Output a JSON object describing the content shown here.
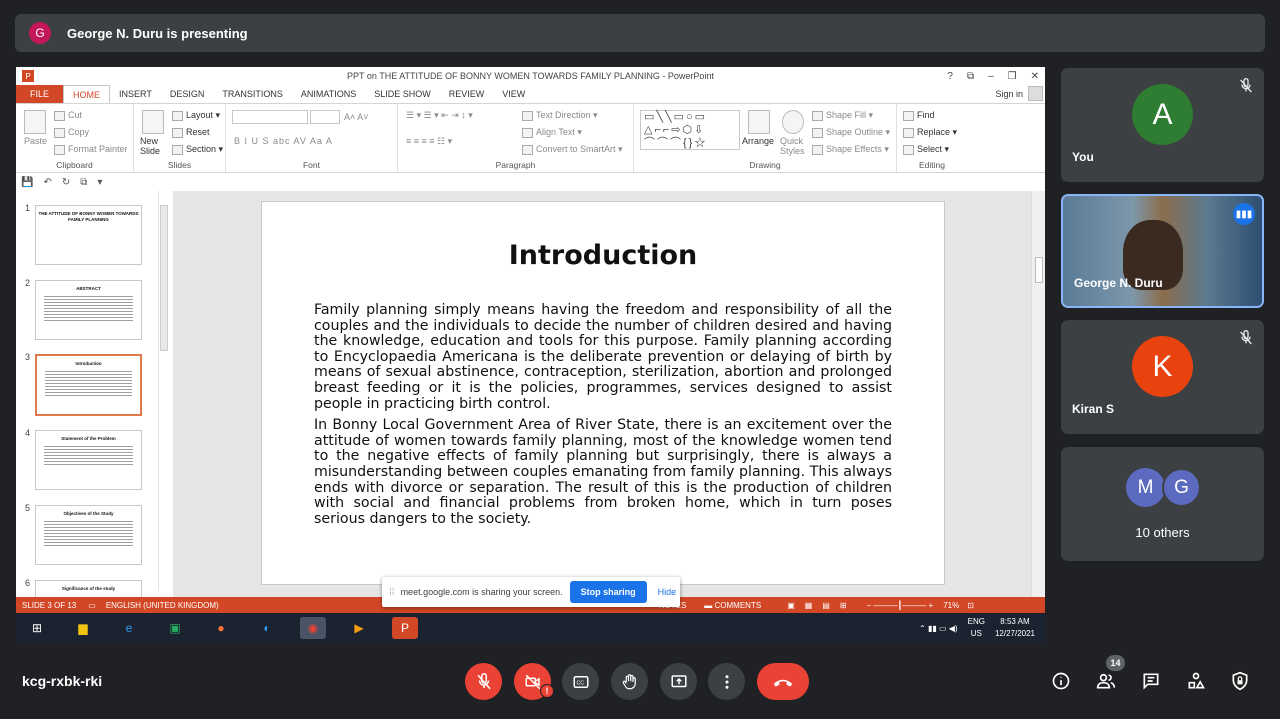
{
  "banner": {
    "avatar_letter": "G",
    "text": "George N. Duru is presenting"
  },
  "ppt": {
    "window_title": "PPT on THE ATTITUDE OF BONNY WOMEN TOWARDS FAMILY PLANNING - PowerPoint",
    "window_controls": [
      "?",
      "⧉",
      "–",
      "❐",
      "✕"
    ],
    "tabs": [
      "FILE",
      "HOME",
      "INSERT",
      "DESIGN",
      "TRANSITIONS",
      "ANIMATIONS",
      "SLIDE SHOW",
      "REVIEW",
      "VIEW"
    ],
    "sign_in": "Sign in",
    "ribbon": {
      "clipboard": {
        "label": "Clipboard",
        "paste": "Paste",
        "cut": "Cut",
        "copy": "Copy",
        "format_painter": "Format Painter"
      },
      "slides": {
        "label": "Slides",
        "new_slide": "New Slide",
        "layout": "Layout",
        "reset": "Reset",
        "section": "Section"
      },
      "font": {
        "label": "Font",
        "buttons": "B  I  U  S  abc  AV  Aa  A"
      },
      "paragraph": {
        "label": "Paragraph",
        "text_direction": "Text Direction",
        "align_text": "Align Text",
        "smartart": "Convert to SmartArt"
      },
      "drawing": {
        "label": "Drawing",
        "arrange": "Arrange",
        "quick_styles": "Quick Styles",
        "shape_fill": "Shape Fill",
        "shape_outline": "Shape Outline",
        "shape_effects": "Shape Effects"
      },
      "editing": {
        "label": "Editing",
        "find": "Find",
        "replace": "Replace",
        "select": "Select"
      }
    },
    "thumbnails": [
      {
        "num": "1",
        "title": "THE ATTITUDE OF BONNY WOMEN TOWARDS FAMILY PLANNING"
      },
      {
        "num": "2",
        "title": "ABSTRACT"
      },
      {
        "num": "3",
        "title": "Introduction"
      },
      {
        "num": "4",
        "title": "Statement of the Problem"
      },
      {
        "num": "5",
        "title": "Objectives of the Study"
      },
      {
        "num": "6",
        "title": "Significance of the study"
      }
    ],
    "slide": {
      "title": "Introduction",
      "paragraphs": [
        "Family planning simply means having the freedom and responsibility of all the couples and the individuals to decide the number of children desired and having the knowledge, education and tools for this purpose. Family planning according to Encyclopaedia Americana is the deliberate prevention or delaying of birth by means of sexual abstinence, contraception, sterilization, abortion and prolonged breast feeding or it is the policies, programmes, services designed to assist people in practicing birth control.",
        "In Bonny Local Government Area of River State, there is an excitement over the attitude of women towards family planning, most of the knowledge women tend to the negative effects of family planning but surprisingly, there is always a misunderstanding between couples emanating from family planning. This always ends with divorce or separation. The result of this is the production of children with social and financial problems from broken home, which in turn poses serious dangers to the society."
      ]
    },
    "status": {
      "slide": "SLIDE 3 OF 13",
      "language": "ENGLISH (UNITED KINGDOM)",
      "notes": "NOTES",
      "comments": "COMMENTS",
      "zoom": "71%"
    },
    "taskbar": {
      "lang": "ENG",
      "region": "US",
      "time": "8:53 AM",
      "date": "12/27/2021"
    }
  },
  "share_notice": {
    "text": "meet.google.com is sharing your screen.",
    "stop": "Stop sharing",
    "hide": "Hide"
  },
  "participants": [
    {
      "name": "You",
      "letter": "A",
      "color": "#2e7d32"
    },
    {
      "name": "George N. Duru",
      "letter": "",
      "color": ""
    },
    {
      "name": "Kiran S",
      "letter": "K",
      "color": "#e8430f"
    }
  ],
  "others": {
    "letters": [
      "M",
      "G"
    ],
    "label": "10 others"
  },
  "meeting": {
    "code": "kcg-rxbk-rki",
    "people_count": "14"
  }
}
